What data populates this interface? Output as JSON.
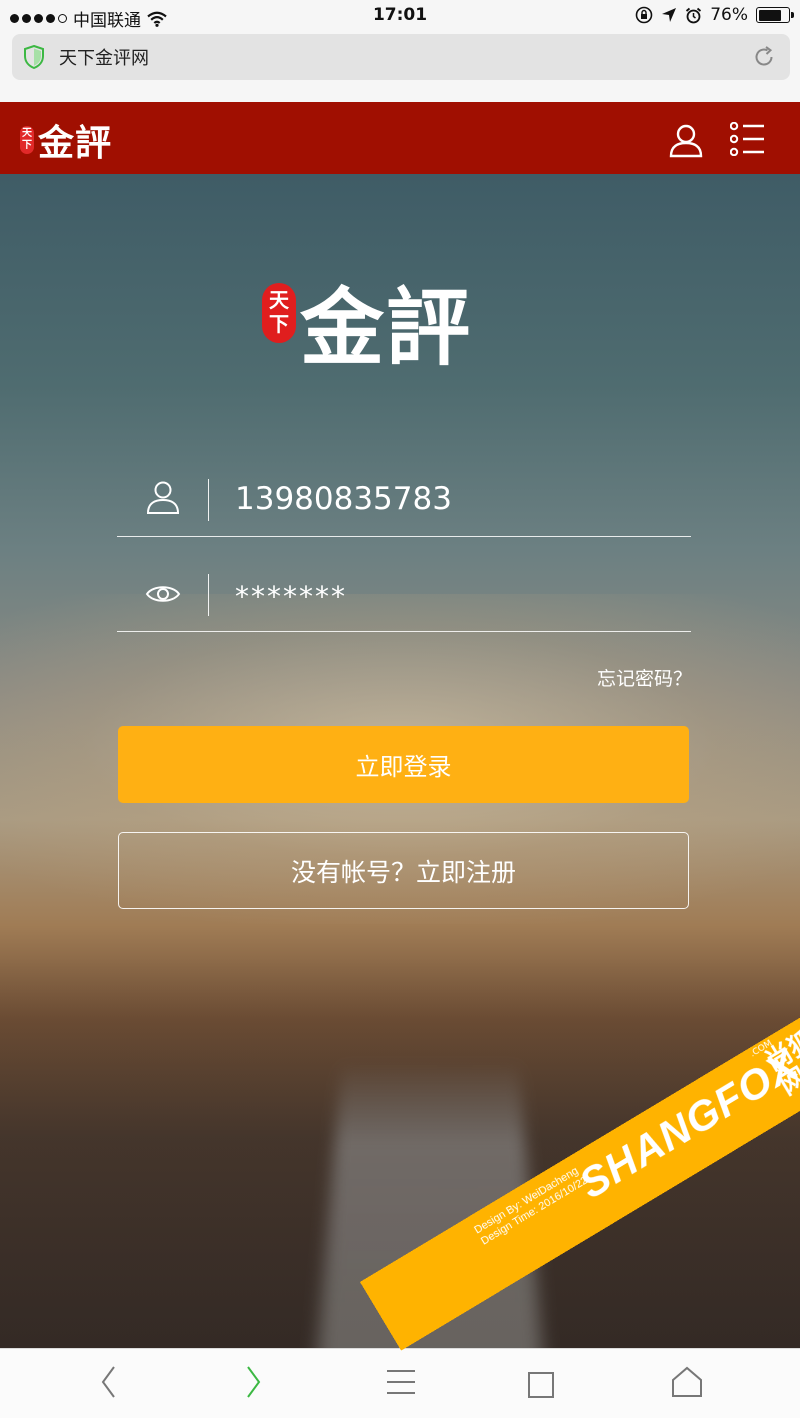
{
  "status_bar": {
    "carrier": "中国联通",
    "time": "17:01",
    "battery": "76%",
    "battery_level": 0.76,
    "signal_bars": 4
  },
  "address_bar": {
    "title": "天下金评网"
  },
  "header": {
    "logo_seal": "天下",
    "logo_text": "金評"
  },
  "hero_logo": {
    "seal": "天下",
    "text": "金評"
  },
  "login_form": {
    "phone_value": "13980835783",
    "password_display": "*******",
    "forgot_label": "忘记密码？",
    "login_label": "立即登录",
    "register_label": "没有帐号？立即注册"
  },
  "watermark": {
    "design_by": "Design By: WeiDacheng",
    "design_time": "Design Time: 2016/10/22",
    "brand": "SHANGFOX",
    "brand_cn": "尚狐网络",
    "domain": ".COM"
  },
  "colors": {
    "header_red": "#a00f01",
    "login_orange": "#ffb013",
    "ribbon": "#ffb300",
    "forward_green": "#3cb843"
  }
}
